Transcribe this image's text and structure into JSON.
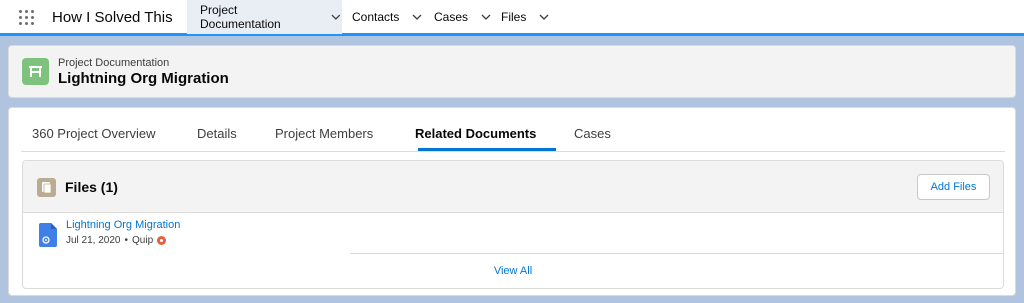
{
  "app": {
    "name": "How I Solved This"
  },
  "nav": {
    "tabs": [
      {
        "label": "Project Documentation",
        "active": true
      },
      {
        "label": "Contacts"
      },
      {
        "label": "Cases"
      },
      {
        "label": "Files"
      }
    ]
  },
  "record": {
    "type": "Project Documentation",
    "name": "Lightning Org Migration",
    "icon": "project-documentation-icon"
  },
  "subtabs": [
    {
      "label": "360 Project Overview"
    },
    {
      "label": "Details"
    },
    {
      "label": "Project Members"
    },
    {
      "label": "Related Documents",
      "active": true
    },
    {
      "label": "Cases"
    }
  ],
  "files": {
    "title": "Files (1)",
    "add_label": "Add Files",
    "items": [
      {
        "name": "Lightning Org Migration",
        "date": "Jul 21, 2020",
        "sep": "•",
        "source": "Quip"
      }
    ],
    "view_all_label": "View All"
  },
  "colors": {
    "accent": "#1b96ff",
    "link": "#0176d3",
    "record_icon": "#7dc37d",
    "files_icon": "#baac93",
    "quip": "#e8603a",
    "doc_icon": "#3f7fe8"
  }
}
